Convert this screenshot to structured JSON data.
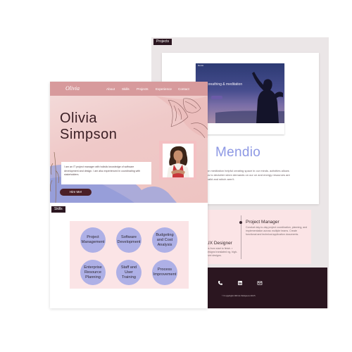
{
  "colors": {
    "brand_pink": "#d79a9c",
    "dark_plum": "#2b1620",
    "lavender": "#aeb0e6",
    "mendio_blue": "#8d98e4",
    "blush": "#fbe4e6"
  },
  "sections": {
    "projects_label": "Projects",
    "skills_label": "Skills"
  },
  "header": {
    "logo": "Olivia",
    "nav": [
      "About",
      "Skills",
      "Projects",
      "Experience",
      "Contact"
    ]
  },
  "hero": {
    "first_name": "Olivia",
    "last_name": "Simpson",
    "bio": "I am an IT project manager with holistic knowledge of software development and design. I am also experienced in coordinating with stakeholders.",
    "hire_button": "Hire Me!"
  },
  "skills": [
    "Project Management",
    "Software Development",
    "Budgeting and Cost Analysis",
    "Enterprise Resource Planning",
    "Staff and User Training",
    "Process Improvement"
  ],
  "project": {
    "site_brand": "Mendio",
    "shot_title": "ind breathing & meditation",
    "name": "Mendio",
    "description": "on meditation helpful creating space in our minds. activities allows us to declutter when demands on our ce and energy resources are valid and which aren't."
  },
  "experience": [
    {
      "title": "Project Manager",
      "text": "Conduct day-to-day project coordination, planning, and implementation across multiple teams. Create functional and technical application documents."
    },
    {
      "title": "UX Designer",
      "text": "ies from start to finish. r designs translated ng, high-level designs."
    }
  ],
  "footer": {
    "icons": [
      "phone-icon",
      "linkedin-icon",
      "mail-icon"
    ],
    "copyright": "©Copyright Olivia Simpson 2023"
  }
}
